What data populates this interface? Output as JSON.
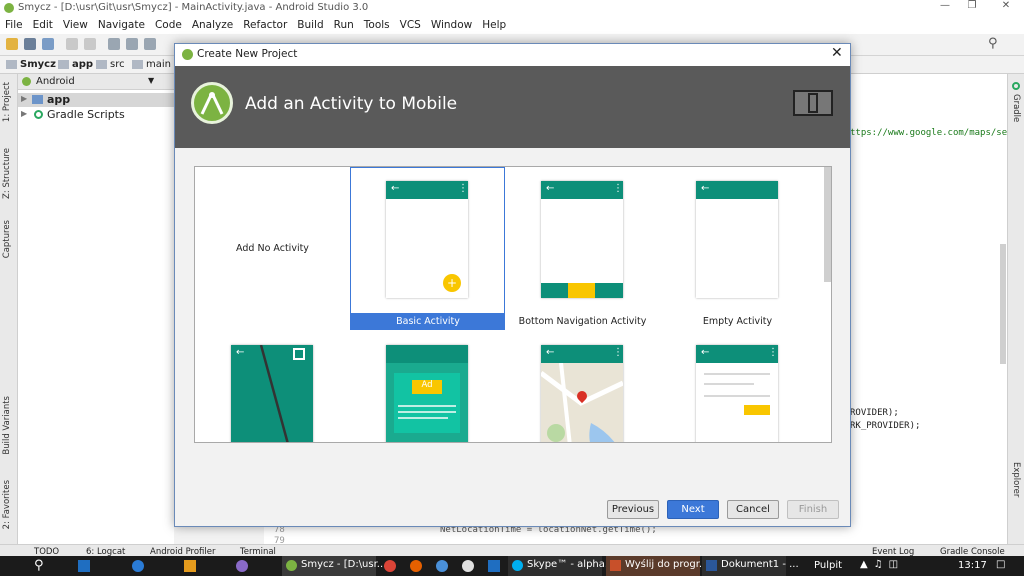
{
  "window": {
    "title": "Smycz - [D:\\usr\\Git\\usr\\Smycz] - MainActivity.java - Android Studio 3.0"
  },
  "menu": [
    "File",
    "Edit",
    "View",
    "Navigate",
    "Code",
    "Analyze",
    "Refactor",
    "Build",
    "Run",
    "Tools",
    "VCS",
    "Window",
    "Help"
  ],
  "breadcrumbs": [
    "Smycz",
    "app",
    "src",
    "main"
  ],
  "project_panel": {
    "view": "Android",
    "items": [
      "app",
      "Gradle Scripts"
    ]
  },
  "left_tabs": [
    "1: Project",
    "Z: Structure",
    "Captures",
    "Build Variants",
    "2: Favorites"
  ],
  "right_tabs": [
    "Gradle",
    "Device File Explorer"
  ],
  "editor_lines": [
    "ttps://www.google.com/maps/sea",
    "ROVIDER);",
    "RK_PROVIDER);"
  ],
  "editor_bottom": {
    "line1": "78",
    "line2": "79",
    "code": "NetLocationTime = locationNet.getTime();"
  },
  "bottom_tools": [
    "TODO",
    "6: Logcat",
    "Android Profiler",
    "Terminal",
    "Event Log",
    "Gradle Console"
  ],
  "dialog": {
    "title": "Create New Project",
    "heading": "Add an Activity to Mobile",
    "templates": [
      {
        "label": "Add No Activity",
        "selected": false
      },
      {
        "label": "Basic Activity",
        "selected": true
      },
      {
        "label": "Bottom Navigation Activity",
        "selected": false
      },
      {
        "label": "Empty Activity",
        "selected": false
      }
    ],
    "ad_label": "Ad",
    "buttons": {
      "previous": "Previous",
      "next": "Next",
      "cancel": "Cancel",
      "finish": "Finish"
    }
  },
  "taskbar": {
    "items": [
      "Smycz - [D:\\usr...",
      "Skype™ - alpha...",
      "Wyślij do progr...",
      "Dokument1 - ..."
    ],
    "pulpit": "Pulpit",
    "time": "13:17"
  },
  "colors": {
    "accent": "#0d8f79",
    "selection": "#3c78d8",
    "dialog_header": "#5a5a5a",
    "fab": "#f9c600"
  }
}
